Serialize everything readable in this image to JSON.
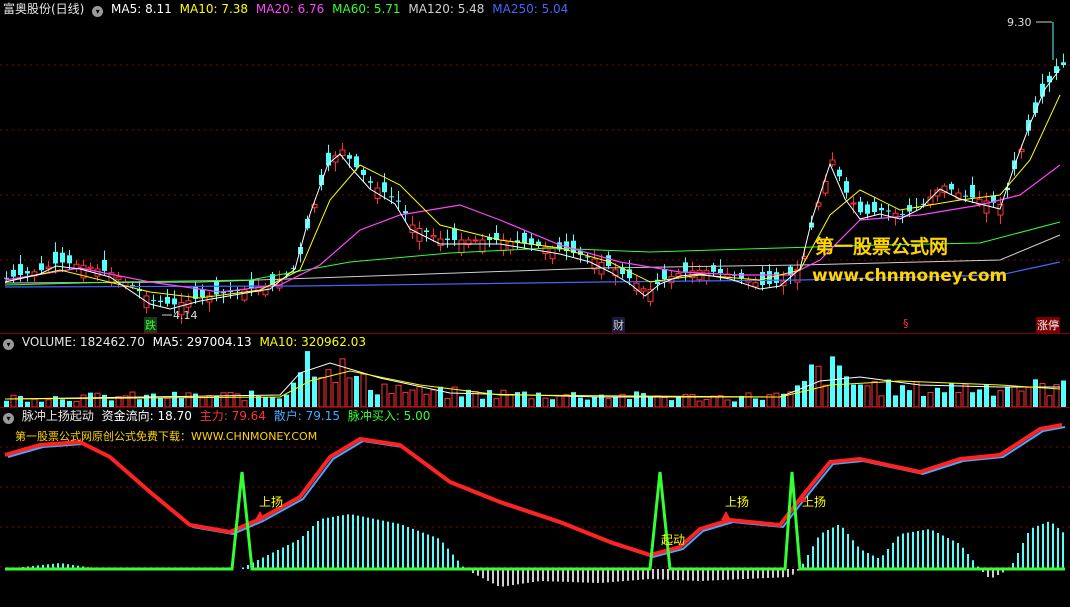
{
  "price_panel": {
    "stock_name": "富奥股份(日线)",
    "ma_items": [
      {
        "label": "MA5: 8.11",
        "color": "#ffffff"
      },
      {
        "label": "MA10: 7.38",
        "color": "#ffff00"
      },
      {
        "label": "MA20: 6.76",
        "color": "#ff44ff"
      },
      {
        "label": "MA60: 5.71",
        "color": "#33ff33"
      },
      {
        "label": "MA120: 5.48",
        "color": "#cfcfcf"
      },
      {
        "label": "MA250: 5.04",
        "color": "#4466ff"
      }
    ],
    "high_label": "9.30",
    "low_label": "4.14",
    "watermark_title": "第一股票公式网",
    "watermark_url": "www.chnmoney.com",
    "markers": [
      {
        "text": "跌",
        "color": "#33ff33"
      },
      {
        "text": "财",
        "color": "#cfcfcf"
      },
      {
        "text": "§",
        "color": "#ff3333"
      },
      {
        "text": "涨停",
        "color": "#ffffff"
      }
    ]
  },
  "volume_panel": {
    "items": [
      {
        "label": "VOLUME: 182462.70",
        "color": "#e8e8e8"
      },
      {
        "label": "MA5: 297004.13",
        "color": "#ffffff"
      },
      {
        "label": "MA10: 320962.03",
        "color": "#ffff00"
      }
    ]
  },
  "indicator_panel": {
    "items": [
      {
        "label": "脉冲上扬起动",
        "color": "#e8e8e8"
      },
      {
        "label": "资金流向: 18.70",
        "color": "#ffffff"
      },
      {
        "label": "主力: 79.64",
        "color": "#ff3333"
      },
      {
        "label": "散户: 79.15",
        "color": "#44aaff"
      },
      {
        "label": "脉冲买入: 5.00",
        "color": "#33ff33"
      }
    ],
    "banner": "第一股票公式网原创公式免费下载：WWW.CHNMONEY.COM",
    "annotations": [
      "上扬",
      "起动",
      "上扬",
      "上扬"
    ]
  },
  "colors": {
    "up": "#ff3333",
    "down": "#54ffff",
    "grid": "#8a0000",
    "hist_pos": "#54ffff",
    "hist_neg": "#cfcfcf"
  },
  "icons": {
    "collapse": "chevron-down-icon"
  }
}
